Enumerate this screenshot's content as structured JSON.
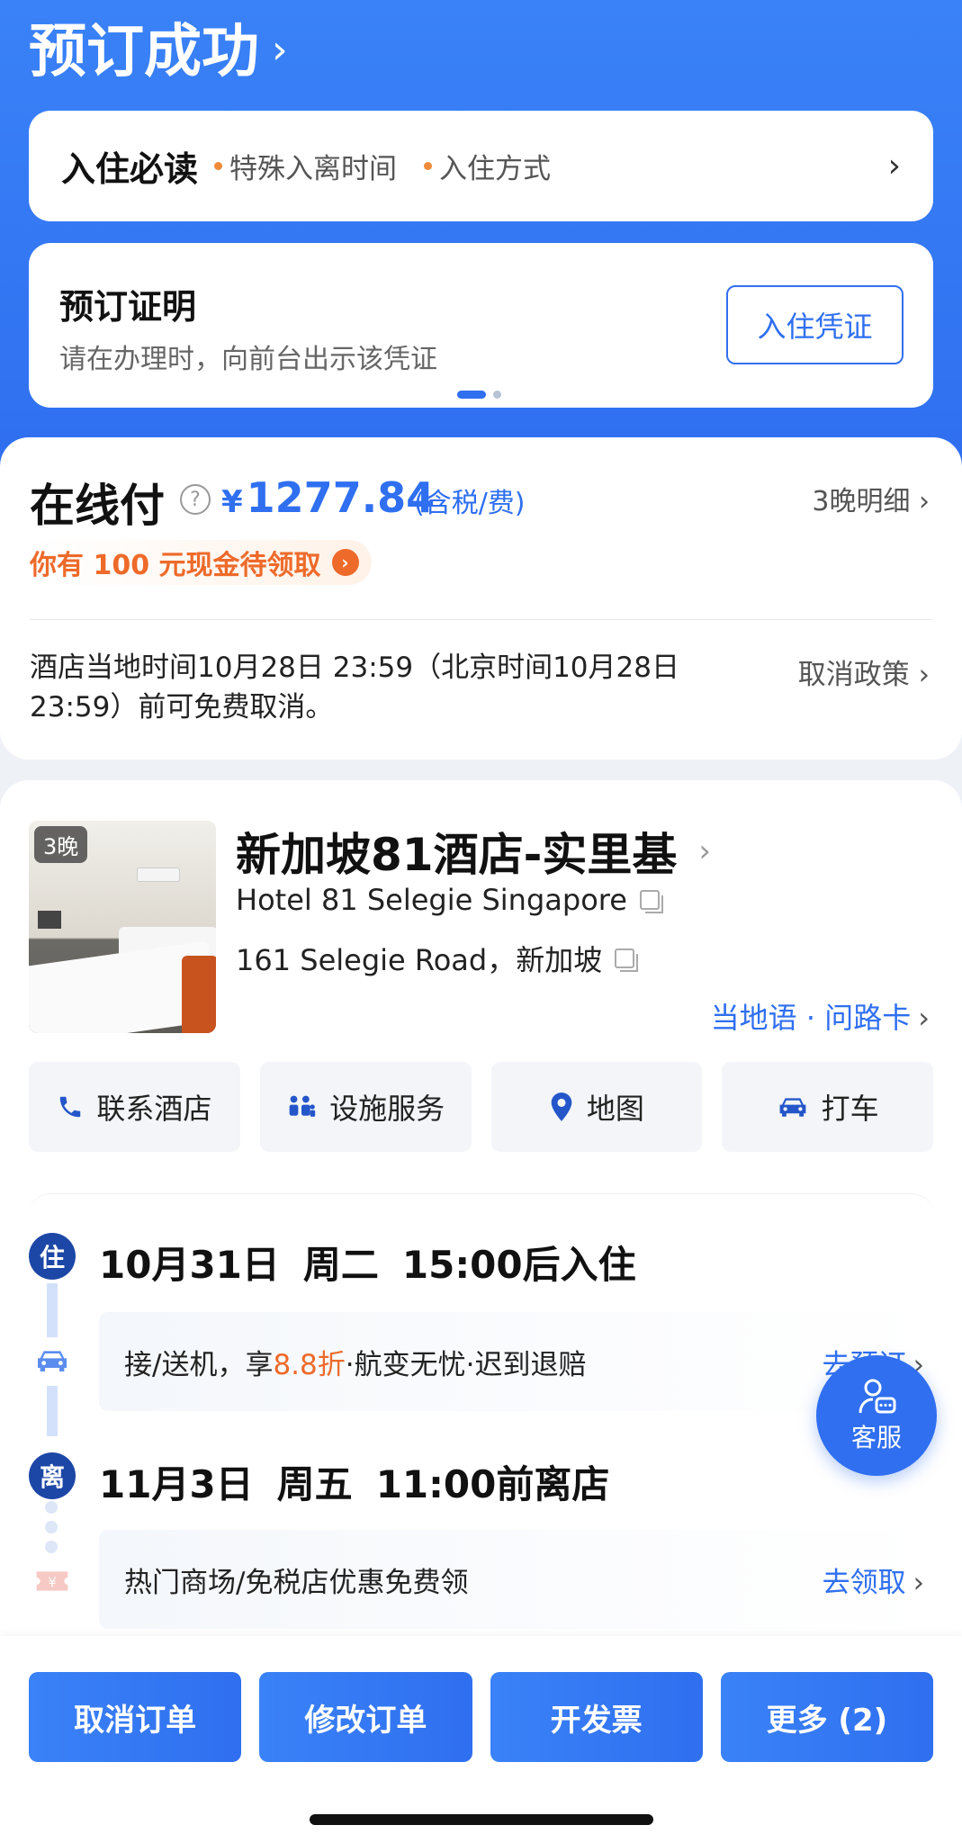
{
  "header": {
    "title": "预订成功",
    "chevron": "›"
  },
  "notice": {
    "title": "入住必读",
    "tags": [
      "特殊入离时间",
      "入住方式"
    ],
    "arrow": "›"
  },
  "proof": {
    "title": "预订证明",
    "subtitle": "请在办理时，向前台出示该凭证",
    "button": "入住凭证"
  },
  "payment": {
    "label": "在线付",
    "help_icon": "?",
    "currency": "¥",
    "amount": "1277.84",
    "tax_note": "(含税/费)",
    "detail_link": "3晚明细 ›",
    "cash_offer": "你有 100 元现金待领取",
    "cancel_text": "酒店当地时间10月28日 23:59（北京时间10月28日 23:59）前可免费取消。",
    "policy_link": "取消政策 ›"
  },
  "hotel": {
    "nights_badge": "3晚",
    "name": "新加坡81酒店-实里基",
    "name_en": "Hotel 81 Selegie Singapore",
    "address": "161 Selegie Road，新加坡",
    "local_card": "当地语 · 问路卡",
    "actions": [
      {
        "label": "联系酒店",
        "icon": "phone-icon"
      },
      {
        "label": "设施服务",
        "icon": "people-icon"
      },
      {
        "label": "地图",
        "icon": "map-pin-icon"
      },
      {
        "label": "打车",
        "icon": "car-icon"
      }
    ]
  },
  "stay": {
    "checkin": {
      "marker": "住",
      "date": "10月31日",
      "weekday": "周二",
      "time": "15:00后入住"
    },
    "transfer_promo": {
      "prefix": "接/送机，享",
      "highlight": "8.8折",
      "suffix": "·航变无忧·迟到退赔",
      "link": "去预订"
    },
    "checkout": {
      "marker": "离",
      "date": "11月3日",
      "weekday": "周五",
      "time": "11:00前离店"
    },
    "mall_promo": {
      "text": "热门商场/免税店优惠免费领",
      "link": "去领取"
    }
  },
  "customer_service": {
    "label": "客服"
  },
  "bottom_bar": {
    "buttons": [
      "取消订单",
      "修改订单",
      "开发票",
      "更多 (2)"
    ]
  },
  "colors": {
    "primary": "#2f6ff0",
    "accent": "#ee6a2a",
    "dark_marker": "#1d47a6"
  }
}
